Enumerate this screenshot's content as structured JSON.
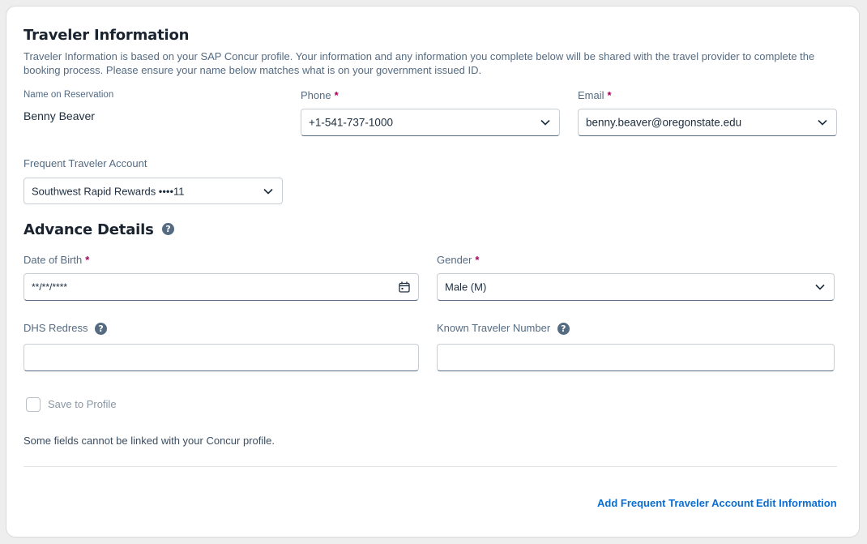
{
  "traveler": {
    "title": "Traveler Information",
    "description": "Traveler Information is based on your SAP Concur profile. Your information and any information you complete below will be shared with the travel provider to complete the booking process. Please ensure your name below matches what is on your government issued ID.",
    "name_label": "Name on Reservation",
    "name_value": "Benny Beaver",
    "phone_label": "Phone",
    "phone_value": "+1-541-737-1000",
    "email_label": "Email",
    "email_value": "benny.beaver@oregonstate.edu",
    "required_marker": "*",
    "frequent_label": "Frequent Traveler Account",
    "frequent_value": "Southwest Rapid Rewards ••••11"
  },
  "advance": {
    "title": "Advance Details",
    "help_glyph": "?",
    "dob_label": "Date of Birth",
    "dob_value": "**/**/****",
    "gender_label": "Gender",
    "gender_value": "Male (M)",
    "dhs_label": "DHS Redress",
    "dhs_value": "",
    "ktn_label": "Known Traveler Number",
    "ktn_value": "",
    "save_label": "Save to Profile",
    "save_checked": false,
    "note": "Some fields cannot be linked with your Concur profile."
  },
  "footer": {
    "add_link": "Add Frequent Traveler Account",
    "edit_link": "Edit Information"
  },
  "colors": {
    "accent": "#0a6ed1",
    "required": "#a4005b",
    "label": "#556b82"
  }
}
